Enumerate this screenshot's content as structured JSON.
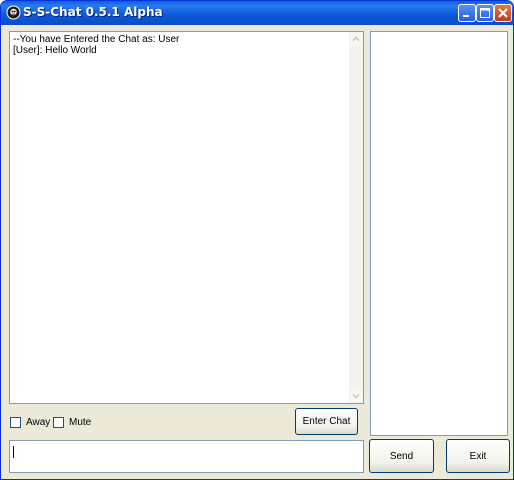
{
  "window": {
    "title": "S-S-Chat 0.5.1 Alpha"
  },
  "chat": {
    "lines": [
      "--You have Entered the Chat as: User",
      "[User]: Hello World"
    ]
  },
  "options": {
    "away_label": "Away",
    "mute_label": "Mute"
  },
  "buttons": {
    "enter_chat": "Enter Chat",
    "send": "Send",
    "exit": "Exit"
  },
  "message_input": {
    "value": ""
  },
  "icons": {
    "app": "app-icon",
    "minimize": "minimize-icon",
    "maximize": "maximize-icon",
    "close": "close-icon"
  },
  "colors": {
    "titlebar": "#0a5fde",
    "close_button": "#c23b14",
    "window_bg": "#ece9d8"
  }
}
